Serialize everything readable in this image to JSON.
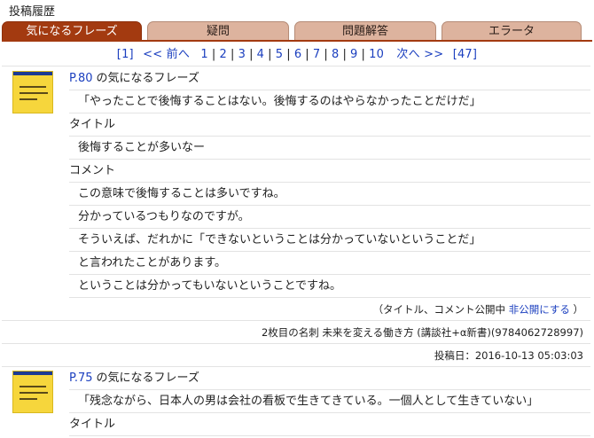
{
  "section_title": "投稿履歴",
  "tabs": [
    {
      "label": "気になるフレーズ",
      "active": true
    },
    {
      "label": "疑問",
      "active": false
    },
    {
      "label": "問題解答",
      "active": false
    },
    {
      "label": "エラータ",
      "active": false
    }
  ],
  "pager": {
    "first": "[1]",
    "prev": "<< 前へ",
    "pages": [
      "1",
      "2",
      "3",
      "4",
      "5",
      "6",
      "7",
      "8",
      "9",
      "10"
    ],
    "next": "次へ >>",
    "last": "[47]"
  },
  "entries": [
    {
      "page_ref": "P.80",
      "heading": "の気になるフレーズ",
      "quote": "「やったことで後悔することはない。後悔するのはやらなかったことだけだ」",
      "title_label": "タイトル",
      "title": "後悔することが多いなー",
      "comment_label": "コメント",
      "comment_lines": [
        "この意味で後悔することは多いですね。",
        "分かっているつもりなのですが。",
        "そういえば、だれかに「できないということは分かっていないということだ」",
        "と言われたことがあります。",
        "ということは分かってもいないということですね。"
      ],
      "visibility_prefix": "（タイトル、コメント公開中",
      "visibility_link": "非公開にする",
      "visibility_suffix": "）",
      "book": "2枚目の名刺 未来を変える働き方 (講談社+α新書)(9784062728997)",
      "posted": "投稿日：2016-10-13 05:03:03"
    },
    {
      "page_ref": "P.75",
      "heading": "の気になるフレーズ",
      "quote": "「残念ながら、日本人の男は会社の看板で生きてきている。一個人として生きていない」",
      "title_label": "タイトル"
    }
  ]
}
